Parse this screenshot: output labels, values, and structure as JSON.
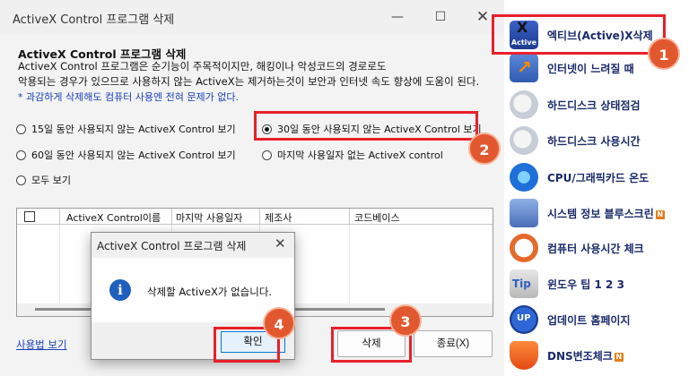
{
  "window": {
    "title": "ActiveX Control 프로그램 삭제",
    "minimize_glyph": "—",
    "maximize_glyph": "☐",
    "close_glyph": "✕"
  },
  "main": {
    "heading": "ActiveX Control 프로그램 삭제",
    "desc_line1": "ActiveX Control 프로그램은 순기능이 주목적이지만, 해킹이나 악성코드의 경로로도",
    "desc_line2": "악용되는 경우가 있으므로 사용하지 않는 ActiveX는 제거하는것이 보안과 인터넷 속도 향상에 도움이 된다.",
    "note": "* 과감하게 삭제해도 컴퓨터 사용엔 전혀 문제가 없다.",
    "radios": [
      {
        "label": "15일 동안 사용되지 않는 ActiveX Control 보기",
        "selected": false
      },
      {
        "label": "30일 동안 사용되지 않는 ActiveX Control 보기",
        "selected": true
      },
      {
        "label": "60일 동안 사용되지 않는 ActiveX Control 보기",
        "selected": false
      },
      {
        "label": "마지막 사용일자 없는 ActiveX control",
        "selected": false
      },
      {
        "label": "모두 보기",
        "selected": false
      }
    ],
    "table_columns": [
      "ActiveX Control이름",
      "마지막 사용일자",
      "제조사",
      "코드베이스"
    ],
    "help_link": "사용법 보기",
    "delete_button": "삭제",
    "exit_button": "종료(X)"
  },
  "dialog": {
    "title": "ActiveX Control 프로그램 삭제",
    "close_glyph": "✕",
    "icon_glyph": "i",
    "message": "삭제할 ActiveX가 없습니다.",
    "ok_button": "확인"
  },
  "side_menu": {
    "items": [
      {
        "label": "엑티브(Active)X삭제",
        "icon": "activex-icon",
        "icon_text": "Active",
        "icon_mark": "X"
      },
      {
        "label": "인터넷이 느려질 때",
        "icon": "internet-speed-icon"
      },
      {
        "label": "하드디스크 상태점검",
        "icon": "hdd-status-icon"
      },
      {
        "label": "하드디스크 사용시간",
        "icon": "hdd-time-icon"
      },
      {
        "label": "CPU/그래픽카드 온도",
        "icon": "cpu-temp-icon"
      },
      {
        "label": "시스템 정보  블루스크린",
        "icon": "system-info-icon",
        "badge": "N"
      },
      {
        "label": "컴퓨터 사용시간 체크",
        "icon": "clock-icon"
      },
      {
        "label": "윈도우 팁 1    2    3",
        "icon": "windows-tip-icon"
      },
      {
        "label": "업데이트     홈페이지",
        "icon": "update-icon"
      },
      {
        "label": "DNS변조체크",
        "icon": "dns-shield-icon",
        "badge": "N"
      }
    ]
  },
  "annotations": [
    "1",
    "2",
    "3",
    "4"
  ],
  "colors": {
    "highlight": "#e8202a",
    "badge": "#e2582e",
    "link": "#1a3fb8",
    "menu_text": "#1a2a6a"
  }
}
